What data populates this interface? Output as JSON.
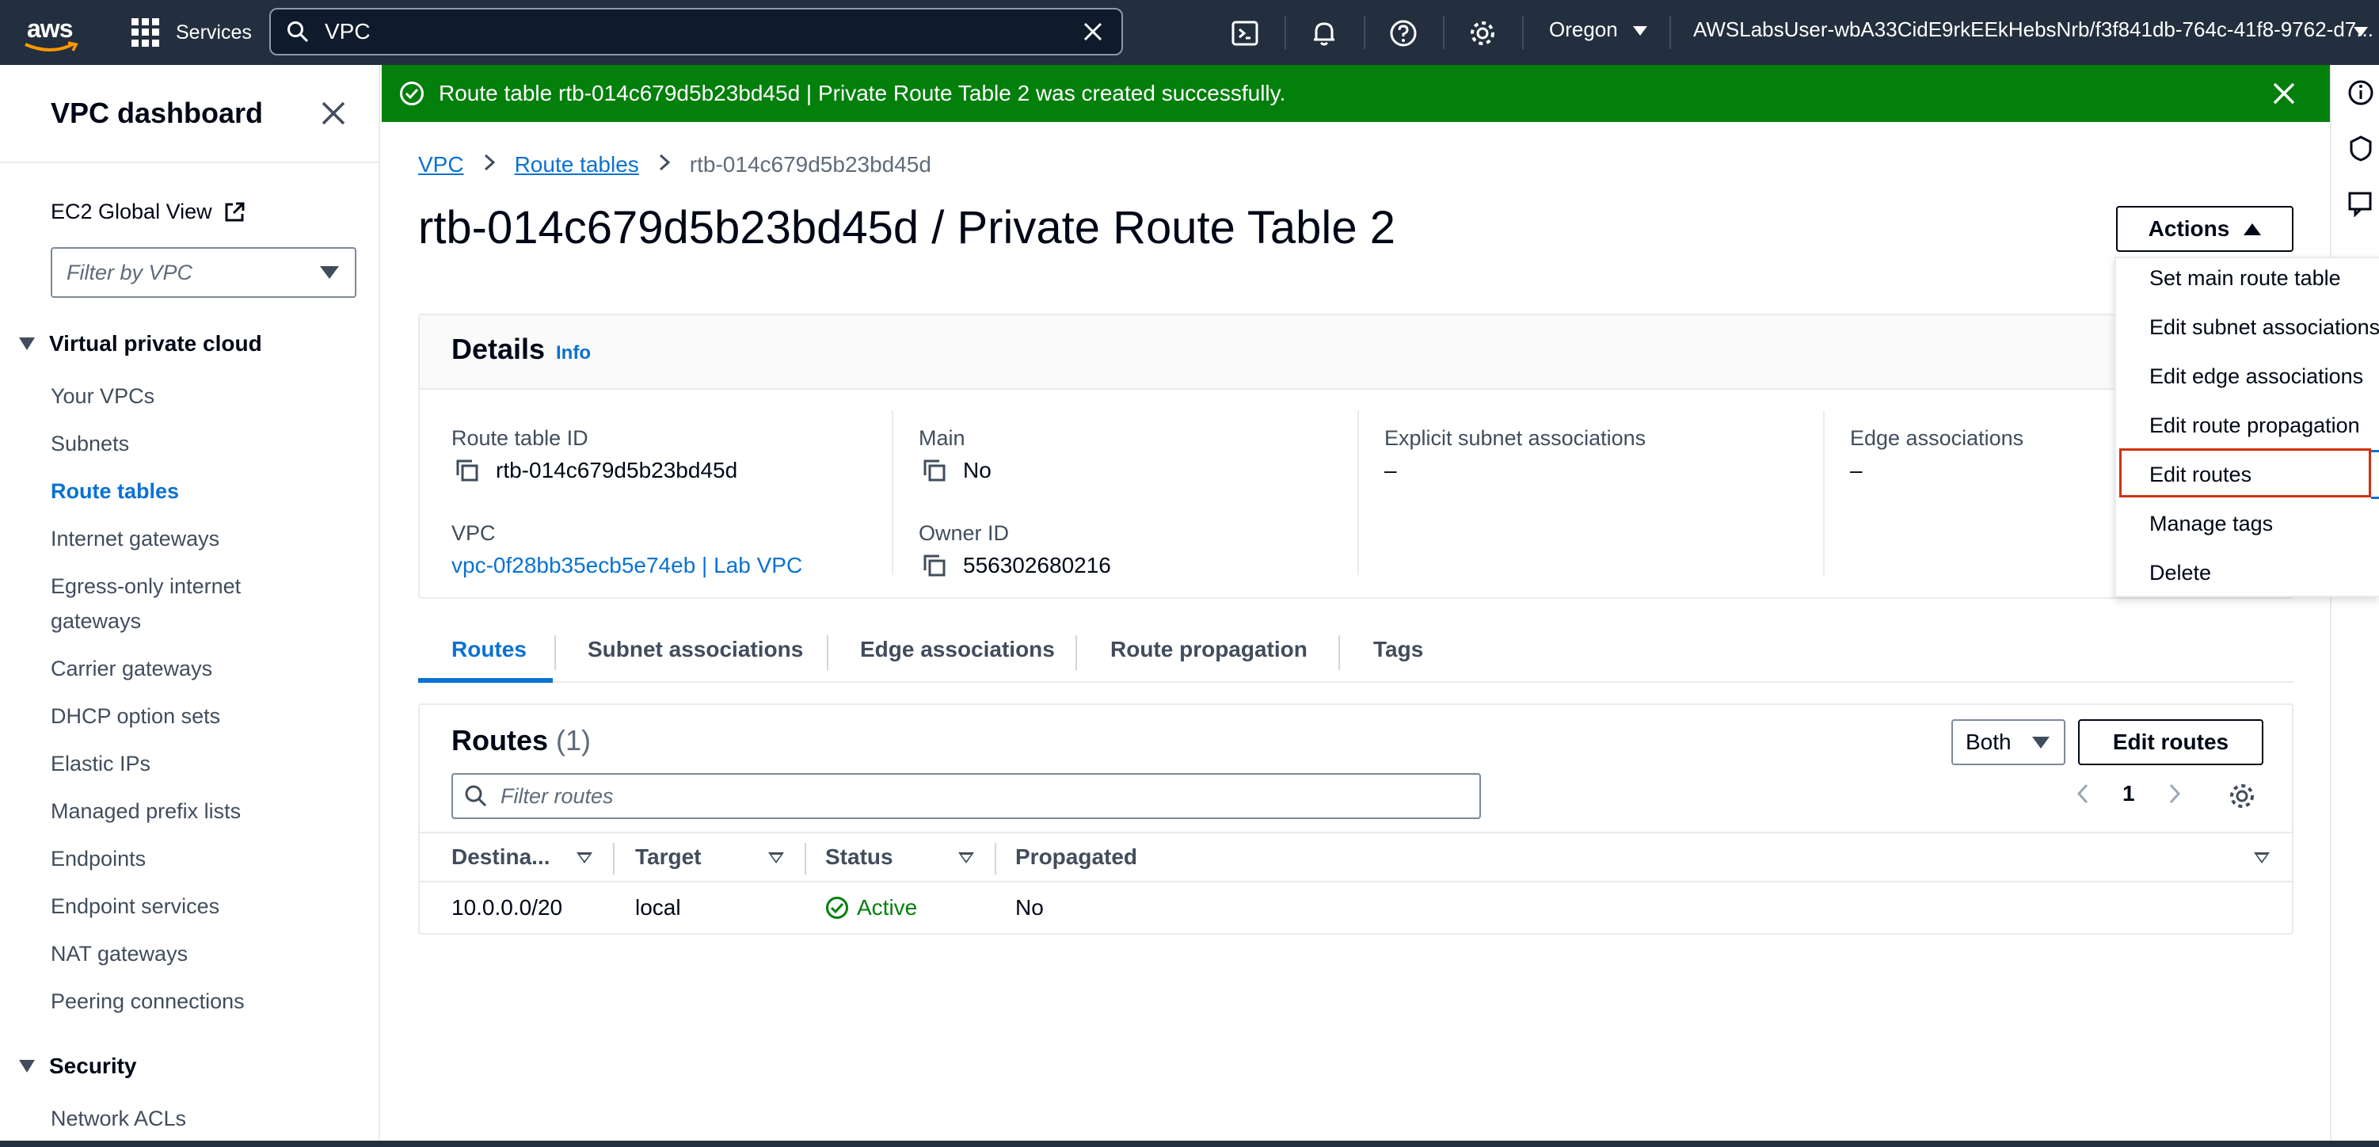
{
  "topnav": {
    "logo": "aws",
    "services_label": "Services",
    "search_value": "VPC",
    "region": "Oregon",
    "account": "AWSLabsUser-wbA33CidE9rkEEkHebsNrb/f3f841db-764c-41f8-9762-d7..."
  },
  "sidebar": {
    "title": "VPC dashboard",
    "global_view": "EC2 Global View",
    "filter_placeholder": "Filter by VPC",
    "section_vpc": "Virtual private cloud",
    "items": [
      "Your VPCs",
      "Subnets",
      "Route tables",
      "Internet gateways",
      "Egress-only internet gateways",
      "Carrier gateways",
      "DHCP option sets",
      "Elastic IPs",
      "Managed prefix lists",
      "Endpoints",
      "Endpoint services",
      "NAT gateways",
      "Peering connections"
    ],
    "active_item": "Route tables",
    "section_security": "Security",
    "security_items": [
      "Network ACLs"
    ]
  },
  "flash": {
    "message": "Route table rtb-014c679d5b23bd45d | Private Route Table 2 was created successfully."
  },
  "breadcrumb": {
    "items": [
      "VPC",
      "Route tables",
      "rtb-014c679d5b23bd45d"
    ]
  },
  "page": {
    "title": "rtb-014c679d5b23bd45d / Private Route Table 2",
    "actions_label": "Actions"
  },
  "actions_menu": {
    "items": [
      "Set main route table",
      "Edit subnet associations",
      "Edit edge associations",
      "Edit route propagation",
      "Edit routes",
      "Manage tags",
      "Delete"
    ],
    "highlighted": "Edit routes"
  },
  "details": {
    "title": "Details",
    "info": "Info",
    "route_table_id_label": "Route table ID",
    "route_table_id": "rtb-014c679d5b23bd45d",
    "vpc_label": "VPC",
    "vpc": "vpc-0f28bb35ecb5e74eb | Lab VPC",
    "main_label": "Main",
    "main": "No",
    "owner_label": "Owner ID",
    "owner": "556302680216",
    "explicit_label": "Explicit subnet associations",
    "explicit": "–",
    "edge_label": "Edge associations",
    "edge": "–"
  },
  "tabs": [
    "Routes",
    "Subnet associations",
    "Edge associations",
    "Route propagation",
    "Tags"
  ],
  "routes": {
    "title": "Routes",
    "count": "(1)",
    "both_label": "Both",
    "edit_label": "Edit routes",
    "filter_placeholder": "Filter routes",
    "page": "1",
    "columns": [
      "Destina...",
      "Target",
      "Status",
      "Propagated"
    ],
    "rows": [
      {
        "destination": "10.0.0.0/20",
        "target": "local",
        "status": "Active",
        "propagated": "No"
      }
    ]
  },
  "colors": {
    "nav_bg": "#232f3e",
    "flash_bg": "#037f0c",
    "link": "#0972d3",
    "highlight": "#d13212"
  }
}
